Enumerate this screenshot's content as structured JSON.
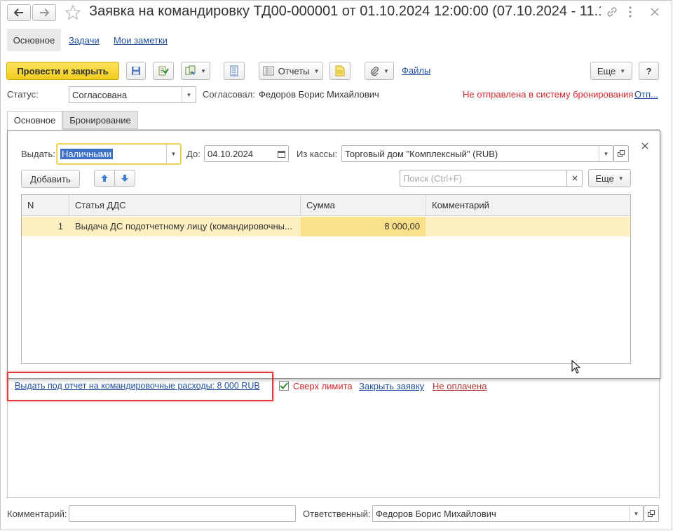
{
  "window": {
    "title": "Заявка на командировку ТД00-000001 от 01.10.2024 12:00:00 (07.10.2024 - 11.1..."
  },
  "nav_tabs": [
    {
      "label": "Основное"
    },
    {
      "label": "Задачи"
    },
    {
      "label": "Мои заметки"
    }
  ],
  "toolbar": {
    "post_close_label": "Провести и закрыть",
    "reports_label": "Отчеты",
    "files_label": "Файлы",
    "more_label": "Еще",
    "help_label": "?"
  },
  "status_row": {
    "status_label": "Статус:",
    "status_value": "Согласована",
    "approved_label": "Согласовал:",
    "approved_value": "Федоров Борис Михайлович",
    "booking_warning": "Не отправлена в систему бронирования",
    "booking_link": "Отп..."
  },
  "inner_tabs": [
    {
      "label": "Основное"
    },
    {
      "label": "Бронирование"
    }
  ],
  "popup": {
    "issue_label": "Выдать:",
    "issue_value": "Наличными",
    "until_label": "До:",
    "until_value": "04.10.2024",
    "cash_label": "Из кассы:",
    "cash_value": "Торговый дом \"Комплексный\" (RUB)",
    "add_label": "Добавить",
    "search_placeholder": "Поиск (Ctrl+F)",
    "more_label": "Еще",
    "columns": [
      "N",
      "Статья ДДС",
      "Сумма",
      "Комментарий"
    ],
    "rows": [
      {
        "n": "1",
        "article": "Выдача ДС подотчетному лицу (командировочны...",
        "sum": "8 000,00",
        "comment": ""
      }
    ]
  },
  "bottom_links": {
    "issue_link": "Выдать под отчет на командировочные расходы: 8 000 RUB",
    "over_limit": "Сверх лимита",
    "close_request": "Закрыть заявку",
    "not_paid": "Не оплачена"
  },
  "footer": {
    "comment_label": "Комментарий:",
    "comment_value": "",
    "responsible_label": "Ответственный:",
    "responsible_value": "Федоров Борис Михайлович"
  },
  "colors": {
    "accent_yellow": "#f5d53a",
    "selected_row": "#fdf0c0",
    "highlight_border": "#e03a3a",
    "link": "#1f4f9e",
    "warning_red": "#d0262d"
  }
}
